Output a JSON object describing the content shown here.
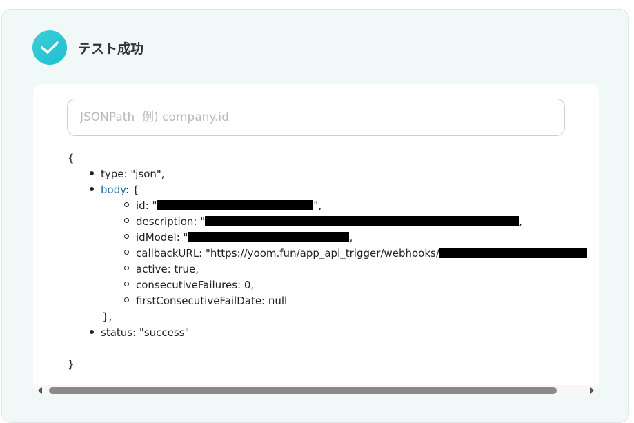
{
  "status": {
    "title": "テスト成功",
    "icon": "check-circle-icon",
    "accent_color": "#1fbfd2"
  },
  "search": {
    "placeholder": "JSONPath  例) company.id"
  },
  "json_view": {
    "open_brace": "{",
    "close_brace": "}",
    "type_line": "type: \"json\",",
    "body_key": "body",
    "body_open": ": {",
    "body_fields": {
      "id_prefix": "id: \"",
      "id_suffix": "\",",
      "description_prefix": "description: \"",
      "description_suffix": ",",
      "idModel_prefix": "idModel: \"",
      "idModel_suffix": ",",
      "callbackURL_prefix": "callbackURL: \"https://yoom.fun/app_api_trigger/webhooks/",
      "active": "active: true,",
      "consecutiveFailures": "consecutiveFailures: 0,",
      "firstConsecutiveFailDate": "firstConsecutiveFailDate: null"
    },
    "body_close": "},",
    "status_line": "status: \"success\""
  },
  "colors": {
    "panel_bg": "#f0f8f8",
    "link_key": "#1f6fa8"
  }
}
